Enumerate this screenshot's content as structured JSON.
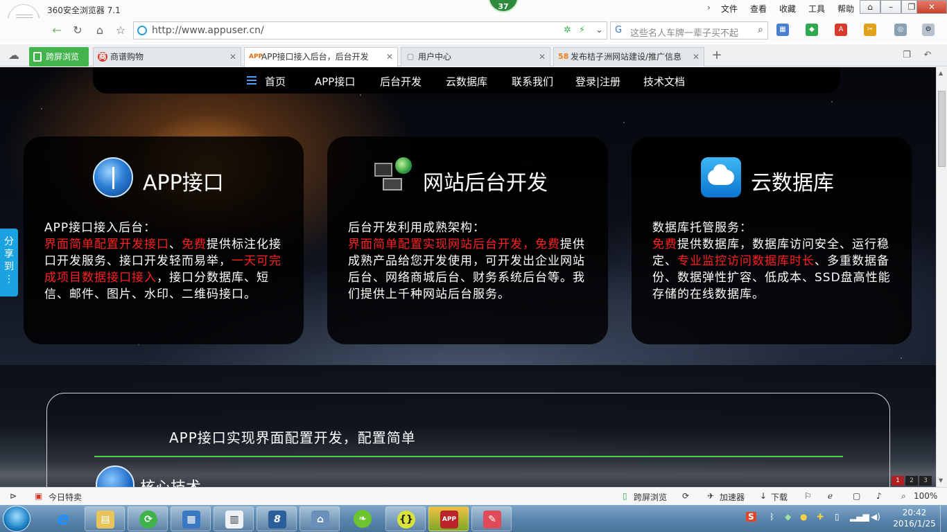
{
  "browser": {
    "title": "360安全浏览器 7.1",
    "badge_count": "37",
    "menus": [
      "文件",
      "查看",
      "收藏",
      "工具",
      "帮助"
    ],
    "address": "http://www.appuser.cn/",
    "search_placeholder": "这些名人车牌一辈子买不起",
    "zoom": "100%"
  },
  "tabs": [
    {
      "label": "跨屏浏览",
      "active": false
    },
    {
      "label": "商谱购物",
      "active": false
    },
    {
      "label": "APP接口接入后台，后台开发",
      "active": true
    },
    {
      "label": "用户中心",
      "active": false
    },
    {
      "label": "发布桔子洲网站建设/推广信息",
      "active": false
    }
  ],
  "tab_icons": {
    "shop": "商",
    "app": "APP",
    "five8": "58"
  },
  "site": {
    "nav": [
      "首页",
      "APP接口",
      "后台开发",
      "云数据库",
      "联系我们",
      "登录|注册",
      "技术文档"
    ],
    "share": [
      "分",
      "享",
      "到",
      "⋮"
    ],
    "cards": [
      {
        "title": "APP接口",
        "intro": "APP接口接入后台：",
        "red1": "界面简单配置开发接口",
        "sep1": "、",
        "red2": "免费",
        "body1": "提供标注化接口开发服务、接口开发轻而易举，",
        "red3": "一天可完成项目数据接口接入",
        "body2": "，接口分数据库、短信、邮件、图片、水印、二维码接口。"
      },
      {
        "title": "网站后台开发",
        "intro": "后台开发利用成熟架构：",
        "red1": "界面简单配置实现网站后台开发，免费",
        "body1": "提供成熟产品给您开发使用，可开发出企业网站后台、网络商城后台、财务系统后台等。我们提供上千种网站后台服务。"
      },
      {
        "title": "云数据库",
        "intro": "数据库托管服务：",
        "red1": "免费",
        "body1": "提供数据库，数据库访问安全、运行稳定、",
        "red2": "专业监控访问数据库时长",
        "body2": "、多重数据备份、数据弹性扩容、低成本、SSD盘高性能存储的在线数据库。"
      }
    ],
    "bottom_title": "APP接口实现界面配置开发，配置简单",
    "core_heading": "核心技术",
    "pager": [
      "1",
      "2",
      "3"
    ]
  },
  "statusbar": {
    "today": "今日特卖",
    "kuaping": "跨屏浏览",
    "accelerator": "加速器",
    "download": "下载",
    "zoom": "100%"
  },
  "taskbar": {
    "time": "20:42",
    "date": "2016/1/25",
    "items": [
      "ie-icon",
      "explorer-icon",
      "refresh-icon",
      "calc-icon",
      "reader-icon",
      "s-icon",
      "network-icon",
      "leaf-icon",
      "braces-icon",
      "app-icon",
      "notes-icon"
    ]
  }
}
